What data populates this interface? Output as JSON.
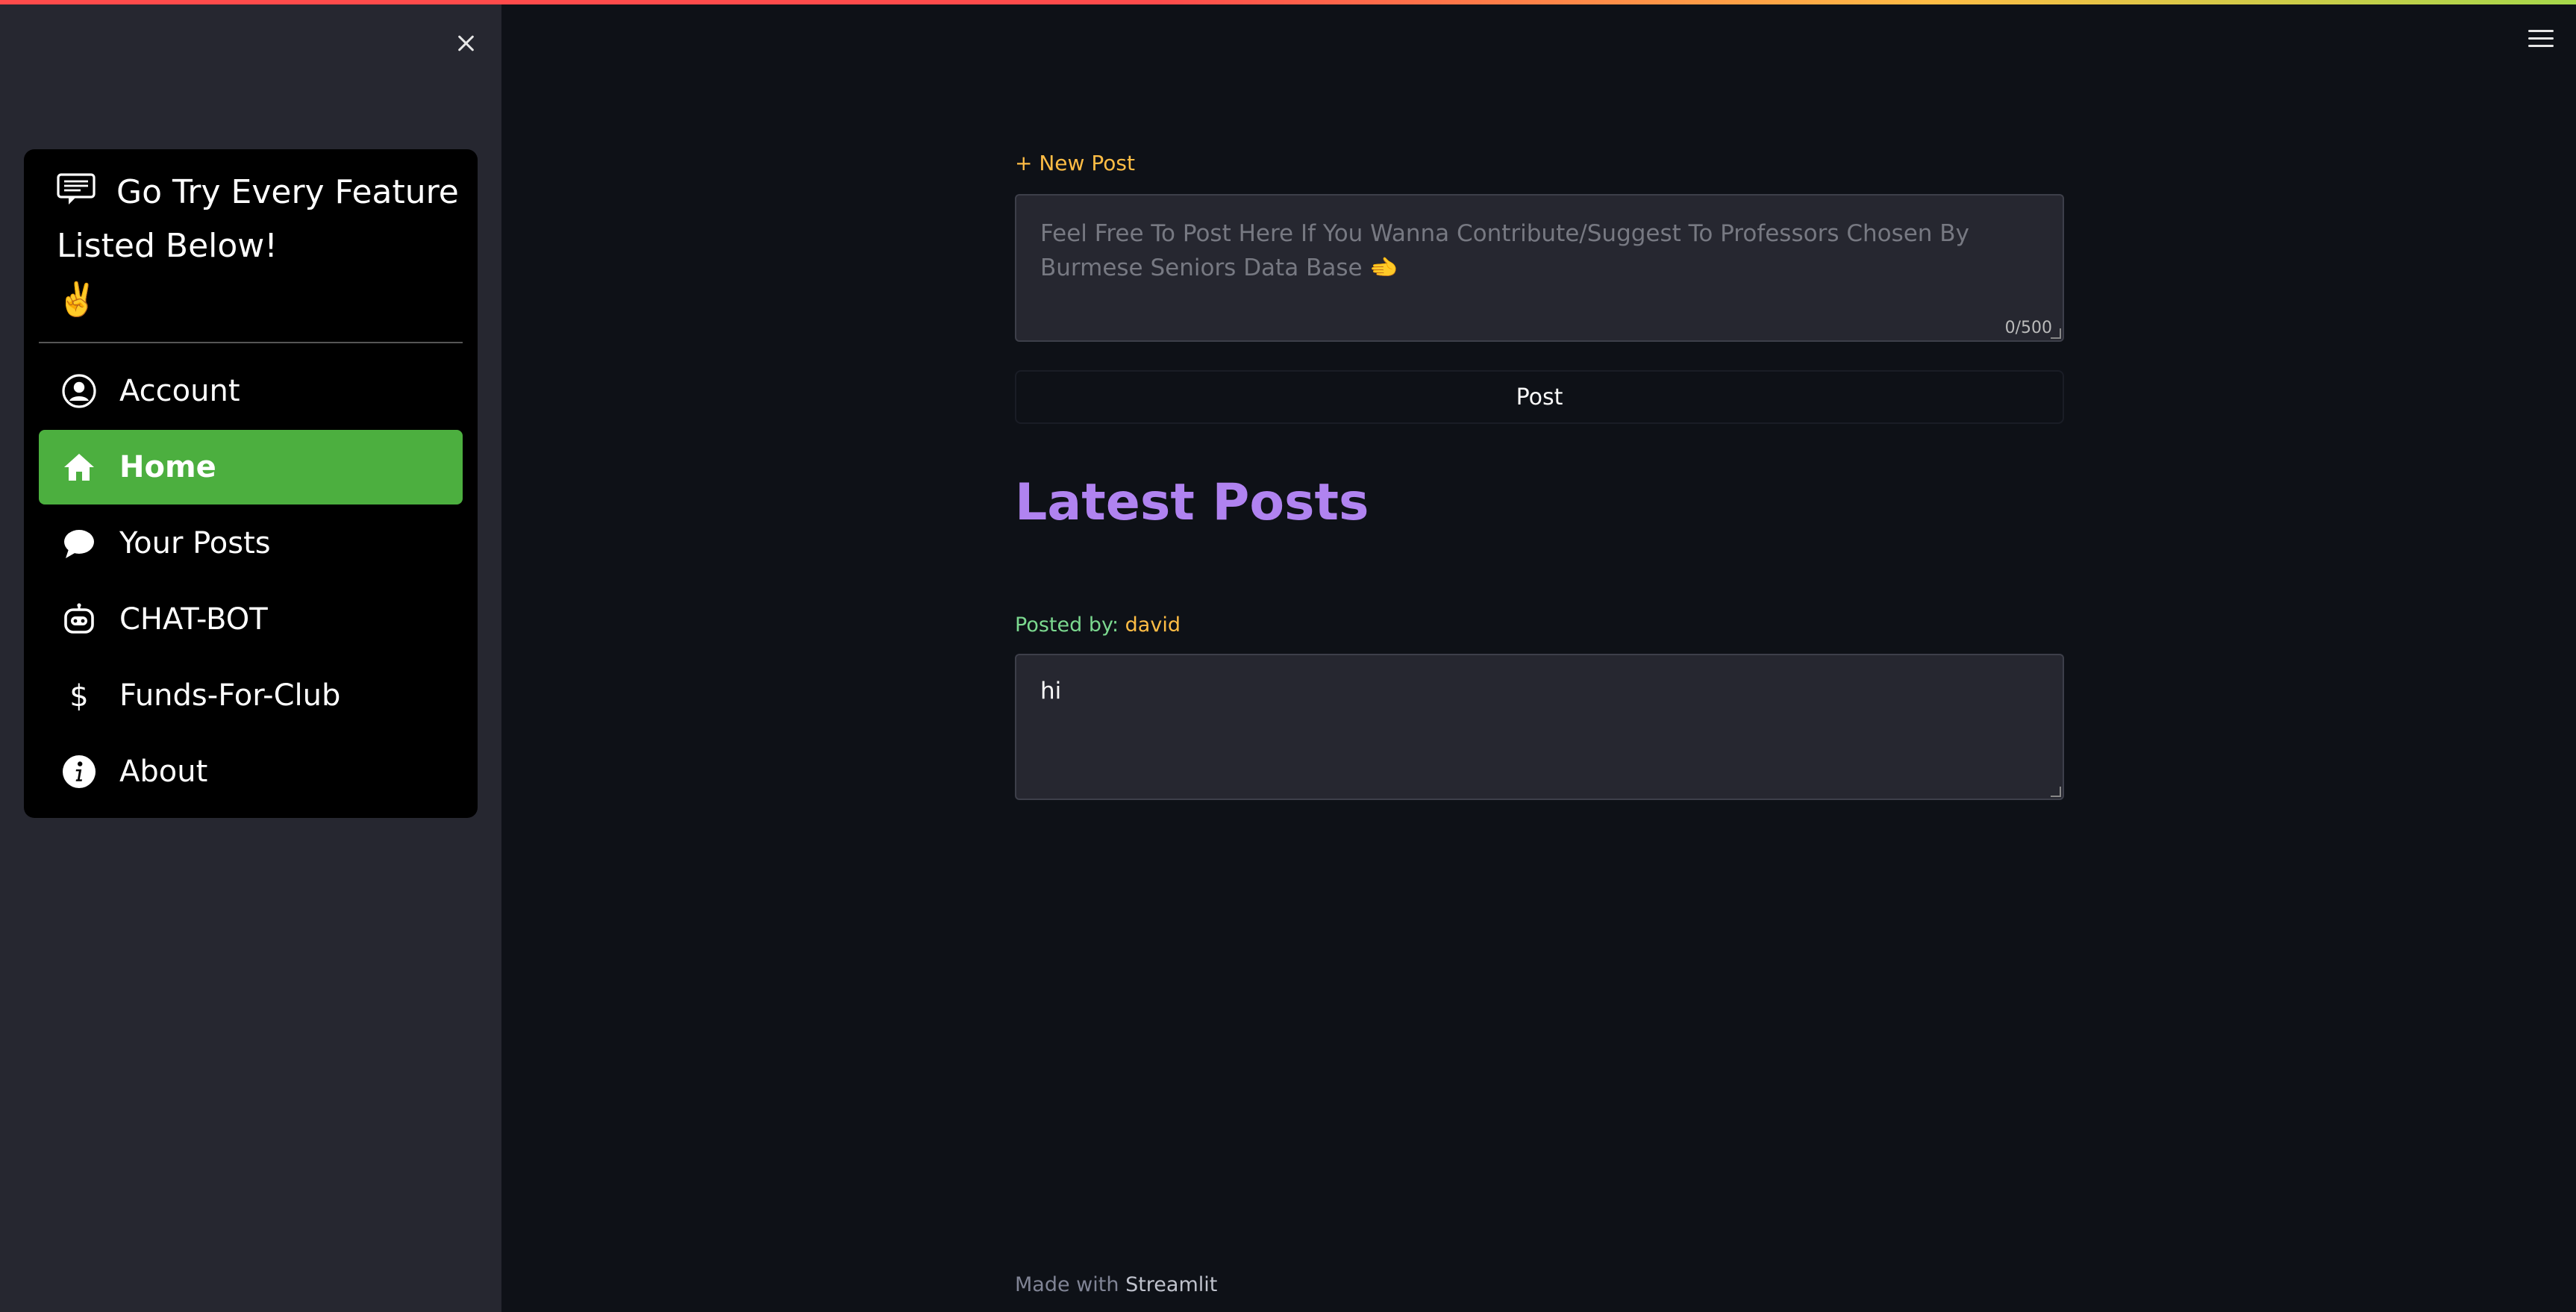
{
  "sidebar": {
    "title": "Go Try Every Feature Listed Below!",
    "title_emoji": "✌️",
    "items": [
      {
        "label": "Account",
        "icon": "person-circle-icon"
      },
      {
        "label": "Home",
        "icon": "house-icon",
        "active": true
      },
      {
        "label": "Your Posts",
        "icon": "chat-bubble-icon"
      },
      {
        "label": "CHAT-BOT",
        "icon": "robot-icon"
      },
      {
        "label": "Funds-For-Club",
        "icon": "dollar-icon"
      },
      {
        "label": "About",
        "icon": "info-circle-icon"
      }
    ]
  },
  "main": {
    "new_post_label": "+ New Post",
    "textarea_placeholder": "Feel Free To Post Here If You Wanna Contribute/Suggest To Professors Chosen By Burmese Seniors Data Base 🫲",
    "char_counter": "0/500",
    "post_button": "Post",
    "latest_heading": "Latest Posts",
    "posts": [
      {
        "posted_by_label": "Posted by:",
        "author": "david",
        "content": "hi"
      }
    ]
  },
  "footer": {
    "made_with": "Made with",
    "brand": "Streamlit"
  },
  "colors": {
    "background": "#0e1117",
    "sidebar": "#262730",
    "active_item": "#4caf3f",
    "heading": "#b083f0",
    "accent_orange": "#ffbd45",
    "posted_by_green": "#7bd88f"
  }
}
